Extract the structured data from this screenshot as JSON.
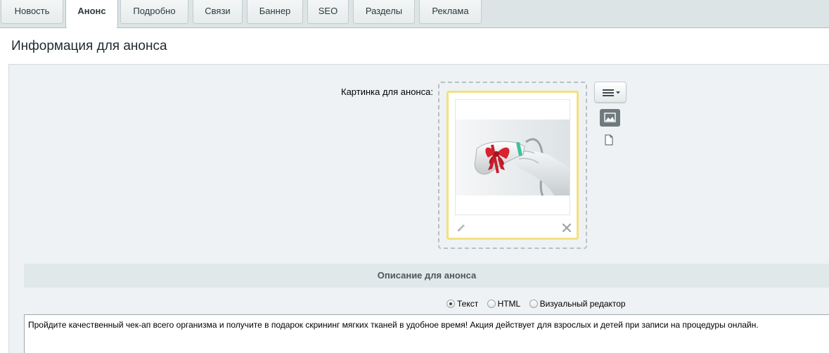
{
  "tabs": [
    {
      "label": "Новость",
      "active": false
    },
    {
      "label": "Анонс",
      "active": true
    },
    {
      "label": "Подробно",
      "active": false
    },
    {
      "label": "Связи",
      "active": false
    },
    {
      "label": "Баннер",
      "active": false
    },
    {
      "label": "SEO",
      "active": false
    },
    {
      "label": "Разделы",
      "active": false
    },
    {
      "label": "Реклама",
      "active": false
    }
  ],
  "section_title": "Информация для анонса",
  "preview_image": {
    "label": "Картинка для анонса:",
    "icons": {
      "menu": "hamburger-menu-icon",
      "dropdown": "caret-down-icon",
      "image_mode": "image-icon",
      "file_mode": "file-icon",
      "edit": "pencil-icon",
      "remove": "close-icon"
    }
  },
  "description": {
    "header": "Описание для анонса",
    "modes": [
      {
        "label": "Текст",
        "checked": true
      },
      {
        "label": "HTML",
        "checked": false
      },
      {
        "label": "Визуальный редактор",
        "checked": false
      }
    ],
    "text": "Пройдите качественный чек-ап всего организма и получите в подарок скрининг мягких тканей в удобное время! Акция действует для взрослых и детей при записи на процедуры онлайн."
  },
  "colors": {
    "tab_bar": "#dce4e6",
    "form_bg": "#eef2f4",
    "card_highlight": "#f4e07e",
    "ribbon": "#d8222f"
  }
}
